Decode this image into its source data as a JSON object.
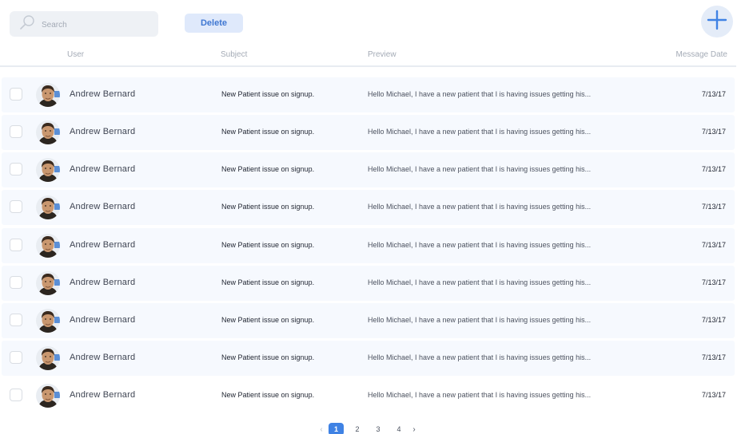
{
  "toolbar": {
    "search_placeholder": "Search",
    "delete_label": "Delete",
    "add_icon": "plus-icon"
  },
  "columns": {
    "user": "User",
    "subject": "Subject",
    "preview": "Preview",
    "date": "Message Date"
  },
  "messages": [
    {
      "user": "Andrew Bernard",
      "subject": "New Patient issue on signup.",
      "preview": "Hello Michael, I have a new patient that I is having issues getting his...",
      "date": "7/13/17"
    },
    {
      "user": "Andrew Bernard",
      "subject": "New Patient issue on signup.",
      "preview": "Hello Michael, I have a new patient that I is having issues getting his...",
      "date": "7/13/17"
    },
    {
      "user": "Andrew Bernard",
      "subject": "New Patient issue on signup.",
      "preview": "Hello Michael, I have a new patient that I is having issues getting his...",
      "date": "7/13/17"
    },
    {
      "user": "Andrew Bernard",
      "subject": "New Patient issue on signup.",
      "preview": "Hello Michael, I have a new patient that I is having issues getting his...",
      "date": "7/13/17"
    },
    {
      "user": "Andrew Bernard",
      "subject": "New Patient issue on signup.",
      "preview": "Hello Michael, I have a new patient that I is having issues getting his...",
      "date": "7/13/17"
    },
    {
      "user": "Andrew Bernard",
      "subject": "New Patient issue on signup.",
      "preview": "Hello Michael, I have a new patient that I is having issues getting his...",
      "date": "7/13/17"
    },
    {
      "user": "Andrew Bernard",
      "subject": "New Patient issue on signup.",
      "preview": "Hello Michael, I have a new patient that I is having issues getting his...",
      "date": "7/13/17"
    },
    {
      "user": "Andrew Bernard",
      "subject": "New Patient issue on signup.",
      "preview": "Hello Michael, I have a new patient that I is having issues getting his...",
      "date": "7/13/17"
    },
    {
      "user": "Andrew Bernard",
      "subject": "New Patient issue on signup.",
      "preview": "Hello Michael, I have a new patient that I is having issues getting his...",
      "date": "7/13/17"
    }
  ],
  "pagination": {
    "prev_icon": "chevron-left-icon",
    "next_icon": "chevron-right-icon",
    "pages": [
      "1",
      "2",
      "3",
      "4"
    ],
    "current": "1"
  },
  "colors": {
    "accent": "#3f82e4",
    "row_background": "#f6f9fe",
    "delete_background": "#dfe9fb"
  }
}
